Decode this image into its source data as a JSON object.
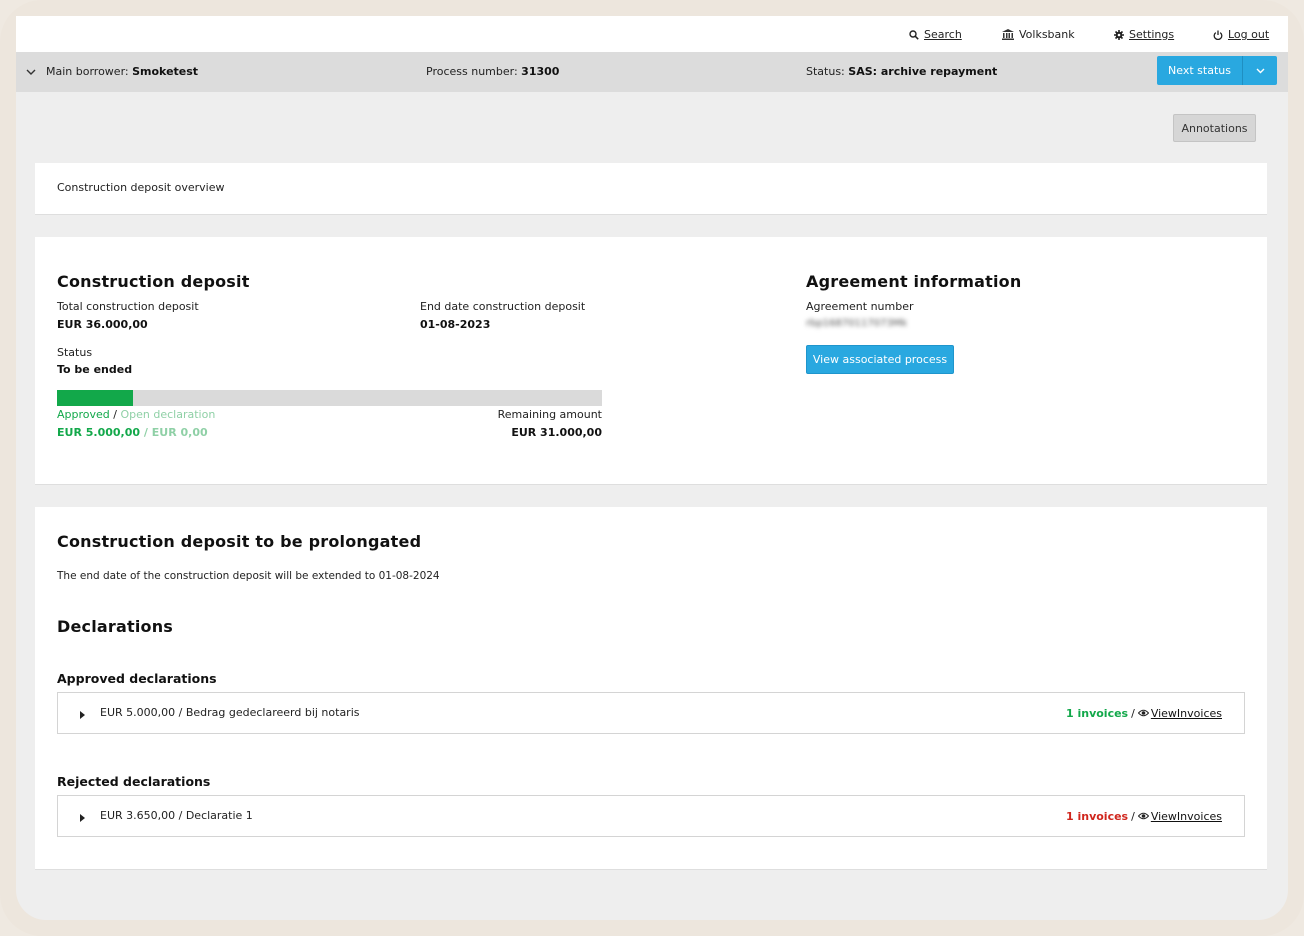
{
  "nav": {
    "search": "Search",
    "bank": "Volksbank",
    "settings": "Settings",
    "logout": "Log out"
  },
  "borrower_bar": {
    "borrower_label": "Main borrower:",
    "borrower_value": "Smoketest",
    "process_label": "Process number:",
    "process_value": "31300",
    "status_label": "Status:",
    "status_value": "SAS: archive repayment",
    "next_status": "Next status"
  },
  "annotations": "Annotations",
  "overview": {
    "title": "Construction deposit overview"
  },
  "deposit": {
    "heading": "Construction deposit",
    "total_label": "Total construction deposit",
    "total_value": "EUR 36.000,00",
    "end_label": "End date construction deposit",
    "end_value": "01-08-2023",
    "status_label": "Status",
    "status_value": "To be ended",
    "progress_approved_fraction": 0.139,
    "approved_label": "Approved",
    "open_label": "Open declaration",
    "separator": "/",
    "approved_value": "EUR 5.000,00",
    "open_value": "EUR 0,00",
    "remaining_label": "Remaining amount",
    "remaining_value": "EUR 31.000,00"
  },
  "agreement": {
    "heading": "Agreement information",
    "number_label": "Agreement number",
    "number_value": "rbp16870117073Mk",
    "view_button": "View associated process"
  },
  "prolong": {
    "heading": "Construction deposit to be prolongated",
    "text": "The end date of the construction deposit will be extended to 01-08-2024"
  },
  "declarations": {
    "heading": "Declarations",
    "approved_heading": "Approved declarations",
    "approved_rows": [
      {
        "text": "EUR 5.000,00 / Bedrag gedeclareerd bij notaris",
        "invoices": "1 invoices",
        "sep": "/",
        "view": "ViewInvoices"
      }
    ],
    "rejected_heading": "Rejected declarations",
    "rejected_rows": [
      {
        "text": "EUR 3.650,00 / Declaratie 1",
        "invoices": "1 invoices",
        "sep": "/",
        "view": "ViewInvoices"
      }
    ]
  },
  "colors": {
    "accent_blue": "#29a8e0",
    "approved_green": "#12a84a",
    "rejected_red": "#d0261d"
  }
}
